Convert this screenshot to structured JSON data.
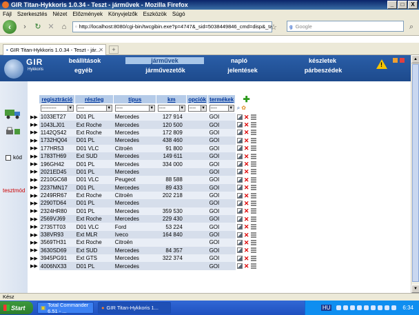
{
  "window": {
    "title": "GIR Titan-Hykkoris 1.0.34 - Teszt - járművek - Mozilla Firefox",
    "buttons": [
      "_",
      "□",
      "X"
    ]
  },
  "browser_menu": [
    "Fájl",
    "Szerkesztés",
    "Nézet",
    "Előzmények",
    "Könyvjelzők",
    "Eszközök",
    "Súgó"
  ],
  "address": {
    "url": "http://localhost:8080/cgi-bin/twcgibin.exe?p=4747&_sid=5038449846_cmd=disp&_table",
    "search_placeholder": "Google"
  },
  "tab": {
    "label": "GIR Titan-Hykkoris 1.0.34 - Teszt - jár..."
  },
  "app": {
    "logo_title": "GIR",
    "logo_sub": "Hykkoris",
    "menu_row1": [
      "beállítások",
      "járművek",
      "napló",
      "készletek"
    ],
    "menu_row2": [
      "egyéb",
      "járművezetők",
      "jelentések",
      "párbeszédek"
    ],
    "active_menu": "járművek"
  },
  "sidebar": {
    "kod_label": "kód",
    "tesztmod_label": "tesztmód"
  },
  "table": {
    "headers": [
      "regisztráció",
      "részleg",
      "típus",
      "km",
      "opciók",
      "termékek"
    ],
    "filters": [
      "---------",
      "----",
      "----",
      "----",
      "----",
      "----"
    ],
    "rows": [
      [
        "1033ET27",
        "D01 PL",
        "Mercedes",
        "127 914",
        "",
        "GOI"
      ],
      [
        "1043LJ01",
        "Ext Roche",
        "Mercedes",
        "120 500",
        "",
        "GOI"
      ],
      [
        "1142QS42",
        "Ext Roche",
        "Mercedes",
        "172 809",
        "",
        "GOI"
      ],
      [
        "1732HQ04",
        "D01 PL",
        "Mercedes",
        "438 460",
        "",
        "GOI"
      ],
      [
        "177HR53",
        "D01 VLC",
        "Citroën",
        "91 800",
        "",
        "GOI"
      ],
      [
        "1783TH69",
        "Ext SUD",
        "Mercedes",
        "149 611",
        "",
        "GOI"
      ],
      [
        "196GH42",
        "D01 PL",
        "Mercedes",
        "334 000",
        "",
        "GOI"
      ],
      [
        "2021ED45",
        "D01 PL",
        "Mercedes",
        "",
        "",
        "GOI"
      ],
      [
        "2210GC68",
        "D01 VLC",
        "Peugeot",
        "88 588",
        "",
        "GOI"
      ],
      [
        "2237MN17",
        "D01 PL",
        "Mercedes",
        "89 433",
        "",
        "GOI"
      ],
      [
        "2249RR67",
        "Ext Roche",
        "Citroën",
        "202 218",
        "",
        "GOI"
      ],
      [
        "2290TD64",
        "D01 PL",
        "Mercedes",
        "",
        "",
        "GOI"
      ],
      [
        "2324HR80",
        "D01 PL",
        "Mercedes",
        "359 530",
        "",
        "GOI"
      ],
      [
        "2569VJ69",
        "Ext Roche",
        "Mercedes",
        "229 430",
        "",
        "GOI"
      ],
      [
        "2735TT03",
        "D01 VLC",
        "Ford",
        "53 224",
        "",
        "GOI"
      ],
      [
        "338VR93",
        "Ext MLR",
        "Iveco",
        "164 840",
        "",
        "GOI"
      ],
      [
        "3569TH31",
        "Ext Roche",
        "Citroën",
        "",
        "",
        "GOI"
      ],
      [
        "3630SD69",
        "Ext SUD",
        "Mercedes",
        "84 357",
        "",
        "GOI"
      ],
      [
        "3945PG91",
        "Ext GTS",
        "Mercedes",
        "322 374",
        "",
        "GOI"
      ],
      [
        "4006NX33",
        "D01 PL",
        "Mercedes",
        "",
        "",
        "GOI"
      ]
    ]
  },
  "status": {
    "text": "Kész"
  },
  "taskbar": {
    "start_label": "Start",
    "tasks": [
      "Total Commander 6.51 - ...",
      "GIR Titan-Hykkoris 1..."
    ],
    "clock": "6:34",
    "lang": "HU"
  },
  "colors": {
    "header_bg": "#1d4a8c",
    "active_menu_bg": "#a8c6e8",
    "row_alt": "#d6deeb",
    "tesztmod": "#cc0000"
  }
}
